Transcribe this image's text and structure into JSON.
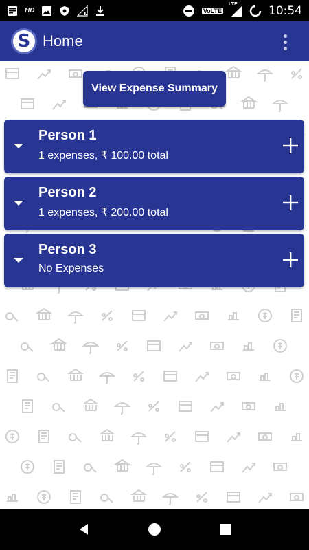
{
  "status_bar": {
    "hd_label": "HD",
    "volte_label": "VoLTE",
    "lte_label": "LTE",
    "time": "10:54",
    "icons": [
      "notes-icon",
      "hd-icon",
      "image-icon",
      "vpn-icon",
      "signal-icon",
      "download-icon",
      "dnd-icon",
      "volte-icon",
      "lte-signal-icon",
      "loading-icon"
    ]
  },
  "app_bar": {
    "logo_letter": "S",
    "title": "Home",
    "color": "#283593"
  },
  "summary_button": {
    "label": "View Expense Summary"
  },
  "persons": [
    {
      "name": "Person 1",
      "summary": "1 expenses, ₹ 100.00 total"
    },
    {
      "name": "Person 2",
      "summary": "1 expenses, ₹ 200.00 total"
    },
    {
      "name": "Person 3",
      "summary": "No Expenses"
    }
  ],
  "nav_bar": {
    "icons": [
      "back-icon",
      "home-icon",
      "recents-icon"
    ]
  },
  "colors": {
    "primary": "#283593",
    "pattern": "#cfcfcf"
  }
}
